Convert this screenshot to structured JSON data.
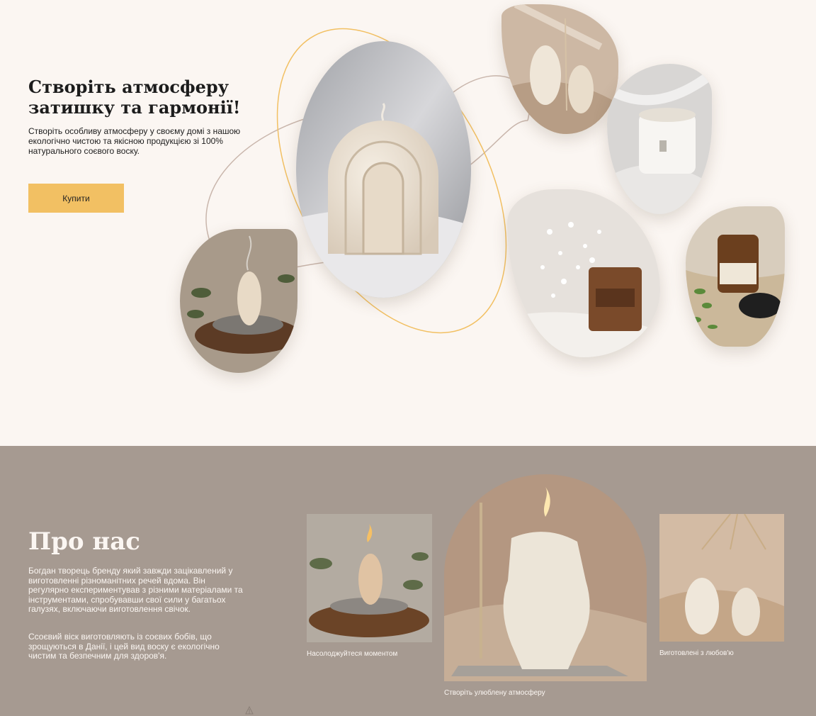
{
  "hero": {
    "title": "Створіть атмосферу затишку та гармонії!",
    "text": "Створіть особливу атмосферу у своєму домі з нашою екологічно чистою та якісною продукцією зі 100% натурального соєвого воску.",
    "buy_label": "Купити"
  },
  "about": {
    "title": "Про нас",
    "paragraph1": "Богдан творець бренду який завжди зацікавлений у виготовленні різноманітних речей вдома. Він регулярно експериментував з різними матеріалами та інструментами, спробувавши свої сили у багатьох галузях, включаючи виготовлення свічок.",
    "paragraph2": "Ссоєвий віск виготовляють із соєвих бобів, що зрощуються в Данії, і цей вид воску є екологічно чистим та безпечним для здоров'я.",
    "captions": [
      "Насолоджуйтеся моментом",
      "Створіть улюблену атмосферу",
      "Виготовлені з любов'ю"
    ]
  },
  "colors": {
    "hero_bg": "#fbf6f2",
    "about_bg": "#a69a91",
    "accent": "#f2c063",
    "text_dark": "#1c1c1c",
    "text_light": "#fbf6f2"
  }
}
